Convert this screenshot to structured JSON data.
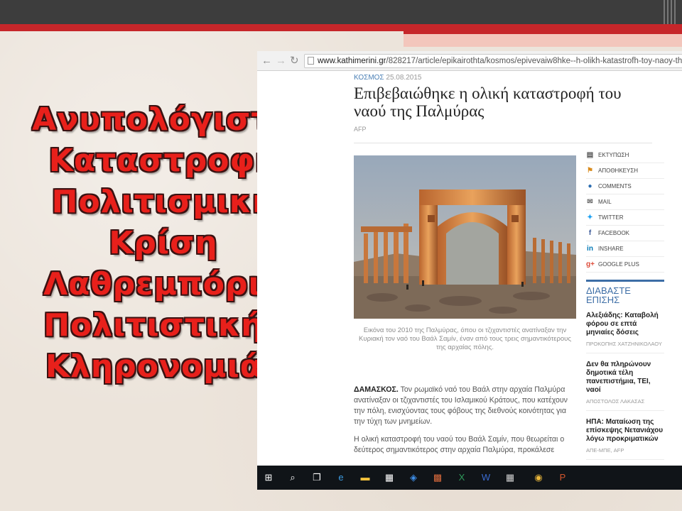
{
  "slide": {
    "title_lines": [
      "Ανυπολόγιστη",
      "Καταστροφή",
      "Πολιτισμική",
      "Κρίση",
      "Λαθρεμπόριο",
      "Πολιτιστικής",
      "Κληρονομιάς"
    ],
    "colors": {
      "title": "#e8201b",
      "accent_red": "#c6262a",
      "background": "#ece4db"
    }
  },
  "browser": {
    "url_domain": "www.kathimerini.gr",
    "url_path": "/828217/article/epikairothta/kosmos/epivevaiw8hke--h-olikh-katastrofh-toy-naoy-th"
  },
  "article": {
    "section": "ΚΟΣΜΟΣ",
    "date": "25.08.2015",
    "headline": "Επιβεβαιώθηκε η ολική καταστροφή του ναού της Παλμύρας",
    "byline": "AFP",
    "caption": "Εικόνα του 2010 της Παλμύρας, όπου οι τζιχαντιστές ανατίναξαν την Κυριακή τον ναό του Βαάλ Σαμίν, έναν από τους τρεις σημαντικότερους της αρχαίας πόλης.",
    "lead_place": "ΔΑΜΑΣΚΟΣ.",
    "paragraph1": "Τον ρωμαϊκό ναό του Βαάλ στην αρχαία Παλμύρα ανατίναξαν οι τζιχαντιστές του Ισλαμικού Κράτους, που κατέχουν την πόλη, ενισχύοντας τους φόβους της διεθνούς κοινότητας για την τύχη των μνημείων.",
    "paragraph2": "Η ολική καταστροφή του ναού του Βαάλ Σαμίν, που θεωρείται ο δεύτερος σημαντικότερος στην αρχαία Παλμύρα, προκάλεσε"
  },
  "share": {
    "items": [
      {
        "label": "ΕΚΤΥΠΩΣΗ",
        "icon": "printer-icon",
        "glyph": "▤",
        "color": "#555555"
      },
      {
        "label": "ΑΠΟΘΗΚΕΥΣΗ",
        "icon": "bookmark-icon",
        "glyph": "⚑",
        "color": "#d98c1f"
      },
      {
        "label": "COMMENTS",
        "icon": "comment-icon",
        "glyph": "●",
        "color": "#2b6cb0"
      },
      {
        "label": "MAIL",
        "icon": "mail-icon",
        "glyph": "✉",
        "color": "#666666"
      },
      {
        "label": "TWITTER",
        "icon": "twitter-icon",
        "glyph": "✦",
        "color": "#1da1f2"
      },
      {
        "label": "FACEBOOK",
        "icon": "facebook-icon",
        "glyph": "f",
        "color": "#3b5998"
      },
      {
        "label": "INSHARE",
        "icon": "linkedin-icon",
        "glyph": "in",
        "color": "#0077b5"
      },
      {
        "label": "GOOGLE PLUS",
        "icon": "google-plus-icon",
        "glyph": "g+",
        "color": "#dd4b39"
      }
    ]
  },
  "read_also": {
    "title_line1": "ΔΙΑΒΑΣΤΕ",
    "title_line2": "ΕΠΙΣΗΣ",
    "items": [
      {
        "headline": "Αλεξιάδης: Καταβολή φόρου σε επτά μηνιαίες δόσεις",
        "author": "ΠΡΟΚΟΠΗΣ ΧΑΤΖΗΝΙΚΟΛΑΟΥ"
      },
      {
        "headline": "Δεν θα πληρώνουν δημοτικά τέλη πανεπιστήμια, ΤΕΙ, ναοί",
        "author": "ΑΠΟΣΤΟΛΟΣ ΛΑΚΑΣΑΣ"
      },
      {
        "headline": "ΗΠΑ: Ματαίωση της επίσκεψης Νετανιάχου λόγω προκριματικών",
        "author": "ΑΠΕ-ΜΠΕ, AFP"
      }
    ]
  },
  "taskbar": {
    "items": [
      {
        "icon": "windows-start-icon",
        "glyph": "⊞",
        "color": "#ffffff"
      },
      {
        "icon": "search-icon",
        "glyph": "⌕",
        "color": "#ffffff"
      },
      {
        "icon": "task-view-icon",
        "glyph": "❐",
        "color": "#ffffff"
      },
      {
        "icon": "edge-icon",
        "glyph": "e",
        "color": "#3c9be0"
      },
      {
        "icon": "file-explorer-icon",
        "glyph": "▬",
        "color": "#f3c13b"
      },
      {
        "icon": "store-icon",
        "glyph": "▦",
        "color": "#ffffff"
      },
      {
        "icon": "dropbox-icon",
        "glyph": "◈",
        "color": "#3d8ee8"
      },
      {
        "icon": "photos-app-icon",
        "glyph": "▩",
        "color": "#d96a3c"
      },
      {
        "icon": "excel-icon",
        "glyph": "X",
        "color": "#2e9a5a"
      },
      {
        "icon": "word-icon",
        "glyph": "W",
        "color": "#3b6bd1"
      },
      {
        "icon": "tablet-app-icon",
        "glyph": "▦",
        "color": "#cfcfcf"
      },
      {
        "icon": "chrome-icon",
        "glyph": "◉",
        "color": "#e8b53a"
      },
      {
        "icon": "powerpoint-icon",
        "glyph": "P",
        "color": "#d4562c"
      }
    ]
  }
}
